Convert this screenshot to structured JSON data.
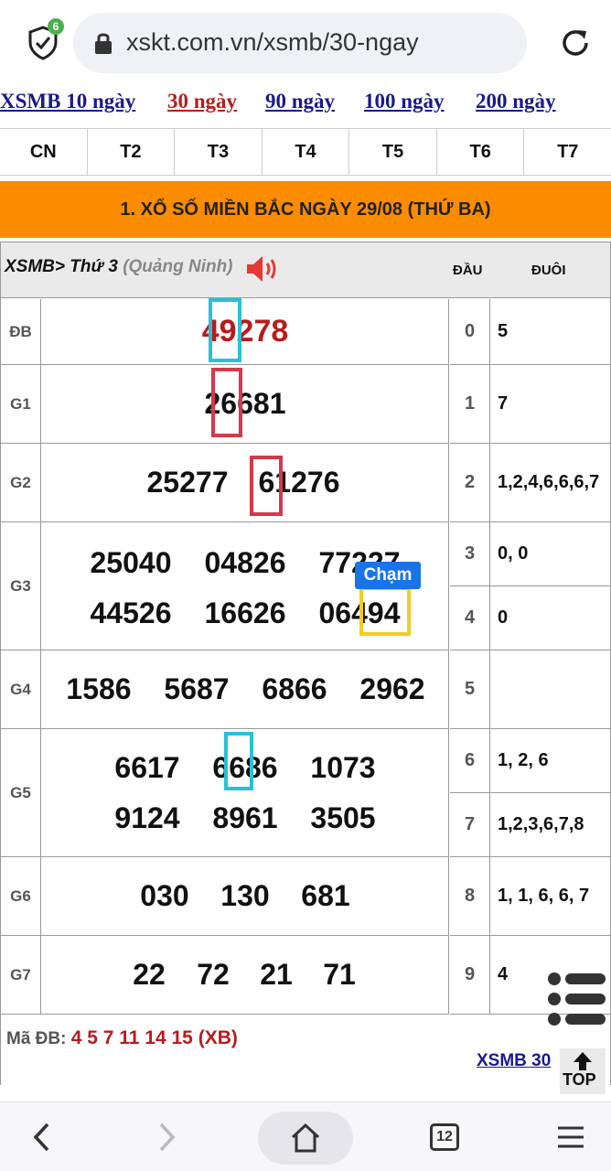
{
  "browser": {
    "url": "xskt.com.vn/xsmb/30-ngay",
    "shield_badge": "6",
    "icons": [
      "shield-icon",
      "lock-icon",
      "reload-icon"
    ]
  },
  "ranges": [
    {
      "label": "XSMB 10 ngày",
      "active": false
    },
    {
      "label": "30 ngày",
      "active": true
    },
    {
      "label": "90 ngày",
      "active": false
    },
    {
      "label": "100 ngày",
      "active": false
    },
    {
      "label": "200 ngày",
      "active": false
    }
  ],
  "days": [
    "CN",
    "T2",
    "T3",
    "T4",
    "T5",
    "T6",
    "T7"
  ],
  "header": "1. XỔ SỐ MIỀN BẮC NGÀY 29/08 (THỨ BA)",
  "subhead": {
    "crumb": "XSMB",
    "sep": ">",
    "day": "Thứ 3",
    "province": "(Quảng Ninh)",
    "dau": "ĐẦU",
    "duoi": "ĐUÔI"
  },
  "prizes": {
    "db": {
      "label": "ĐB",
      "values": [
        "49278"
      ]
    },
    "g1": {
      "label": "G1",
      "values": [
        "26681"
      ]
    },
    "g2": {
      "label": "G2",
      "values": [
        "25277",
        "61276"
      ]
    },
    "g3": {
      "label": "G3",
      "values": [
        "25040",
        "04826",
        "77227",
        "44526",
        "16626",
        "06494"
      ]
    },
    "g4": {
      "label": "G4",
      "values": [
        "1586",
        "5687",
        "6866",
        "2962"
      ]
    },
    "g5": {
      "label": "G5",
      "values": [
        "6617",
        "6686",
        "1073",
        "9124",
        "8961",
        "3505"
      ]
    },
    "g6": {
      "label": "G6",
      "values": [
        "030",
        "130",
        "681"
      ]
    },
    "g7": {
      "label": "G7",
      "values": [
        "22",
        "72",
        "21",
        "71"
      ]
    }
  },
  "loto": [
    {
      "dau": "0",
      "duoi": "5"
    },
    {
      "dau": "1",
      "duoi": "7"
    },
    {
      "dau": "2",
      "duoi": "1,2,4,6,6,6,7"
    },
    {
      "dau": "3",
      "duoi": "0, 0"
    },
    {
      "dau": "4",
      "duoi": "0"
    },
    {
      "dau": "5",
      "duoi": ""
    },
    {
      "dau": "6",
      "duoi": "1, 2, 6"
    },
    {
      "dau": "7",
      "duoi": "1,2,3,6,7,8"
    },
    {
      "dau": "8",
      "duoi": "1, 1, 6, 6, 7"
    },
    {
      "dau": "9",
      "duoi": "4"
    }
  ],
  "tooltip": "Chạm",
  "ma_db": {
    "label": "Mã ĐB:",
    "value": "4 5 7 11 14 15 (XB)"
  },
  "xsmb_link": "XSMB 30",
  "top_label": "TOP",
  "tabs_count": "12",
  "colors": {
    "accent": "#fb8c00",
    "prize_red": "#b71c1c",
    "link_blue": "#1a1a8a",
    "highlight_cyan": "#29c0d8",
    "highlight_red": "#d33a4a",
    "highlight_yellow": "#f2cc22"
  }
}
